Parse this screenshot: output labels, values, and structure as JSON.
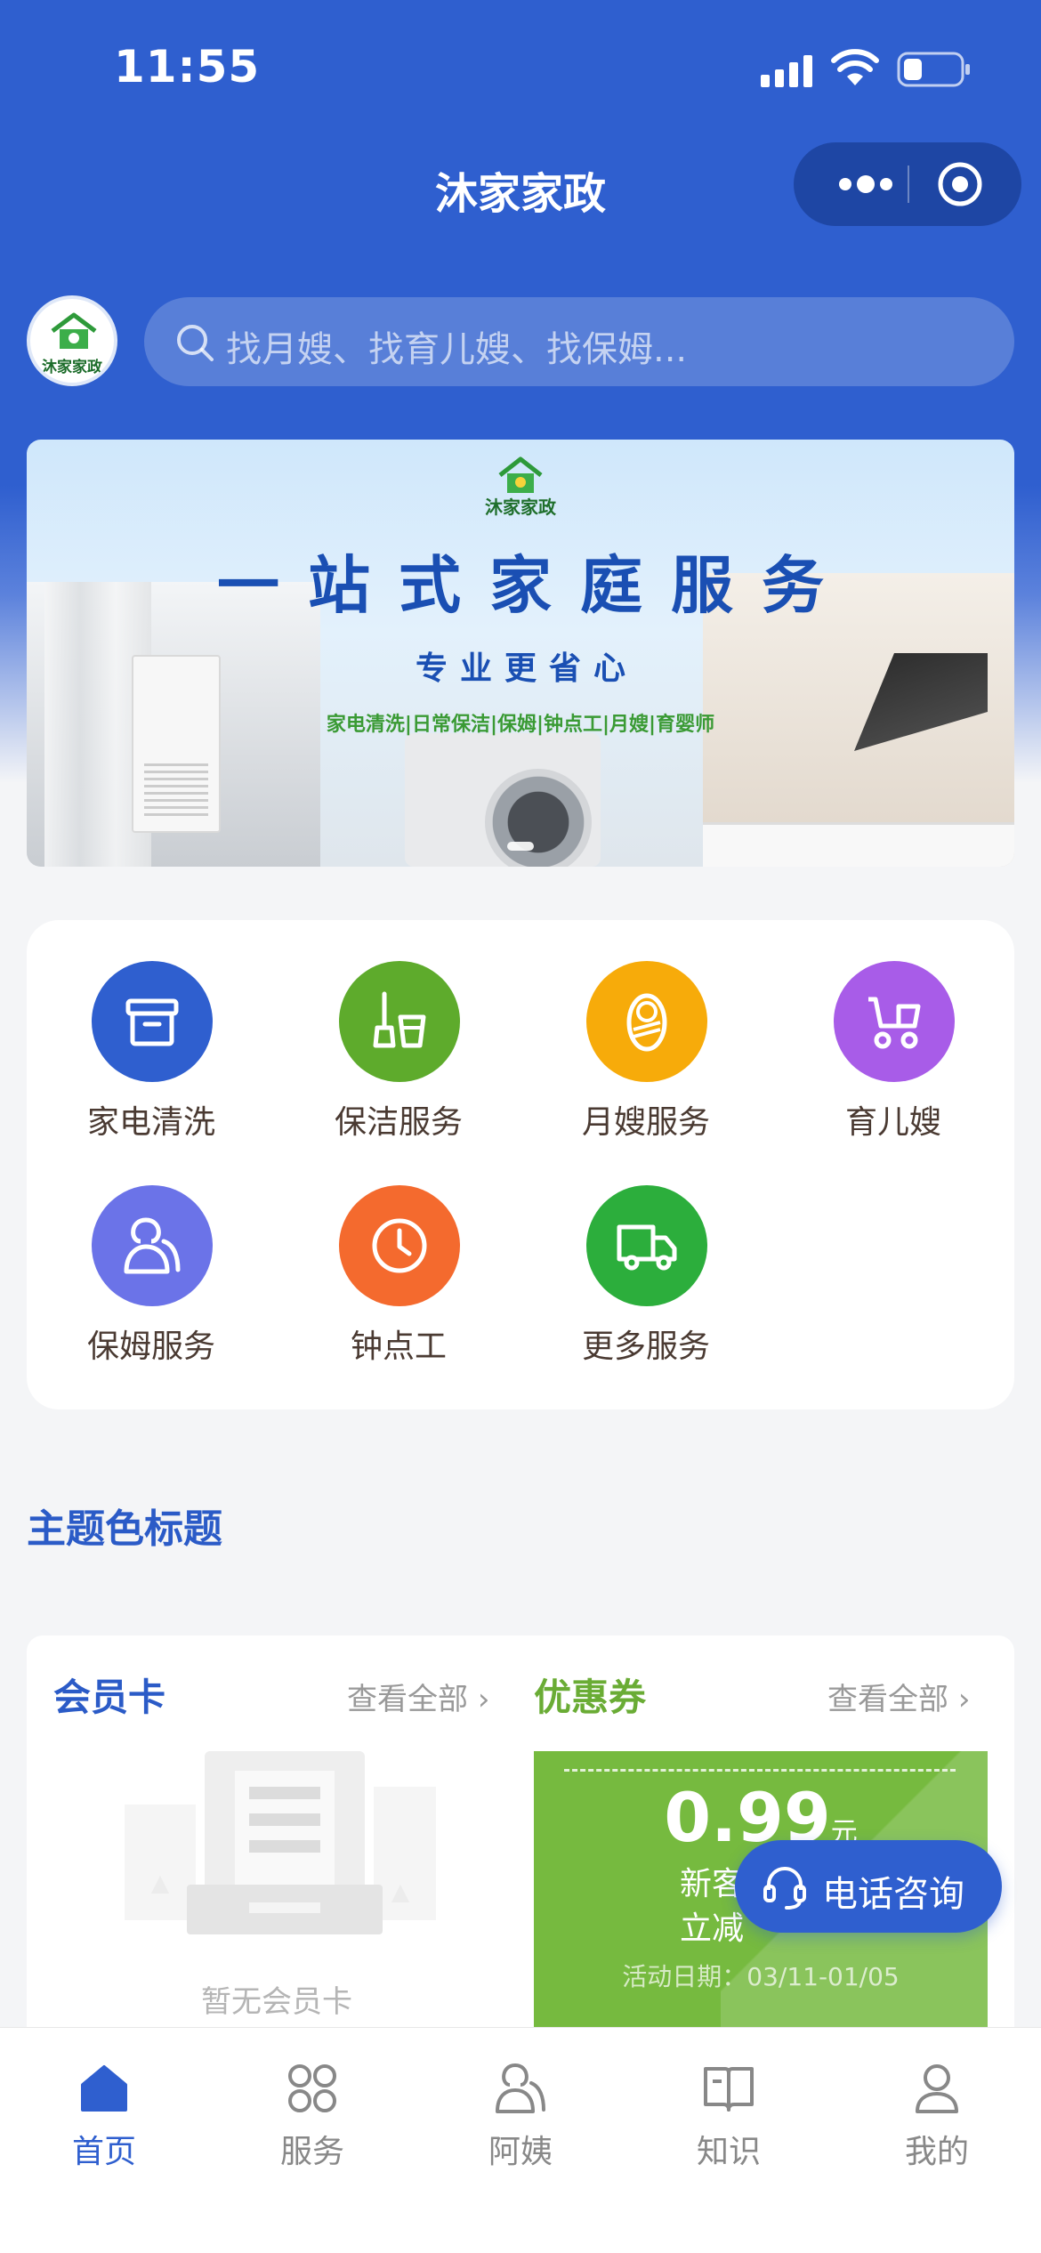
{
  "status_bar": {
    "time": "11:55"
  },
  "nav": {
    "title": "沐家家政"
  },
  "brand": {
    "logo_text": "沐家家政"
  },
  "search": {
    "placeholder": "找月嫂、找育儿嫂、找保姆..."
  },
  "banner": {
    "logo_text": "沐家家政",
    "title": "一站式家庭服务",
    "subtitle": "专业更省心",
    "services": "家电清洗|日常保洁|保姆|钟点工|月嫂|育婴师"
  },
  "services": [
    {
      "label": "家电清洗",
      "icon": "box-icon",
      "color": "#2f5fcf"
    },
    {
      "label": "保洁服务",
      "icon": "cleaning-icon",
      "color": "#5eab2c"
    },
    {
      "label": "月嫂服务",
      "icon": "baby-icon",
      "color": "#f7ab0a"
    },
    {
      "label": "育儿嫂",
      "icon": "stroller-icon",
      "color": "#a85ce8"
    },
    {
      "label": "保姆服务",
      "icon": "nanny-icon",
      "color": "#6b73e8"
    },
    {
      "label": "钟点工",
      "icon": "clock-icon",
      "color": "#f46a2e"
    },
    {
      "label": "更多服务",
      "icon": "truck-icon",
      "color": "#2cae3c"
    }
  ],
  "section_title": "主题色标题",
  "member_card": {
    "title": "会员卡",
    "view_all": "查看全部",
    "empty_text": "暂无会员卡"
  },
  "coupon_section": {
    "title": "优惠券",
    "view_all": "查看全部",
    "amount": "0.99",
    "unit": "元",
    "line1": "新客",
    "line2": "立减",
    "date": "活动日期：03/11-01/05"
  },
  "phone_button": {
    "label": "电话咨询"
  },
  "tabbar": [
    {
      "label": "首页",
      "icon": "home-icon",
      "active": true
    },
    {
      "label": "服务",
      "icon": "grid-icon",
      "active": false
    },
    {
      "label": "阿姨",
      "icon": "aunt-icon",
      "active": false
    },
    {
      "label": "知识",
      "icon": "book-icon",
      "active": false
    },
    {
      "label": "我的",
      "icon": "user-icon",
      "active": false
    }
  ],
  "colors": {
    "primary": "#2f5fcf",
    "accent_green": "#76ba3f"
  }
}
